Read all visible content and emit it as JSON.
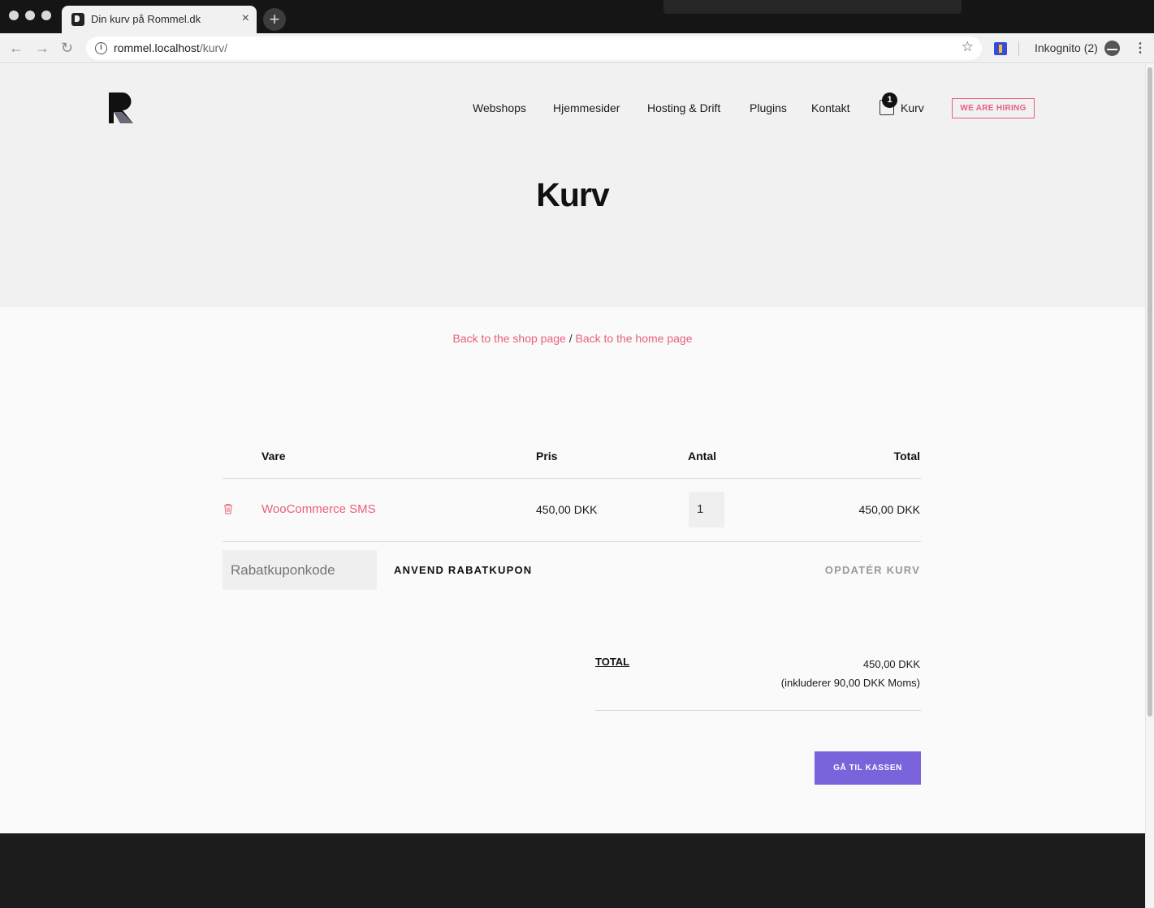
{
  "browser": {
    "tab_title": "Din kurv på Rommel.dk",
    "tab_close": "×",
    "new_tab": "+",
    "url_host": "rommel.localhost",
    "url_path": "/kurv/",
    "incognito_label": "Inkognito (2)",
    "back_glyph": "←",
    "forward_glyph": "→",
    "reload_glyph": "↻",
    "star_glyph": "☆",
    "menu_glyph": "⋮"
  },
  "header": {
    "nav": [
      "Webshops",
      "Hjemmesider",
      "Hosting & Drift",
      "Plugins",
      "Kontakt"
    ],
    "cart_label": "Kurv",
    "cart_count": "1",
    "hiring_label": "WE ARE HIRING"
  },
  "page": {
    "title": "Kurv",
    "back_shop": "Back to the shop page",
    "back_separator": "/",
    "back_home": "Back to the home page"
  },
  "cart_table": {
    "headers": {
      "product": "Vare",
      "price": "Pris",
      "quantity": "Antal",
      "total": "Total"
    },
    "items": [
      {
        "name": "WooCommerce SMS",
        "price": "450,00 DKK",
        "quantity": "1",
        "total": "450,00 DKK"
      }
    ],
    "coupon_placeholder": "Rabatkuponkode",
    "apply_coupon": "ANVEND RABATKUPON",
    "update_cart": "OPDATÉR KURV"
  },
  "totals": {
    "label": "TOTAL",
    "value": "450,00 DKK",
    "tax_note": "(inkluderer 90,00 DKK Moms)",
    "checkout_button": "GÅ TIL KASSEN"
  },
  "colors": {
    "accent_pink": "#e8607d",
    "checkout_purple": "#7b63dc",
    "hero_bg": "#f1f1f1",
    "footer_bg": "#1c1c1c"
  }
}
